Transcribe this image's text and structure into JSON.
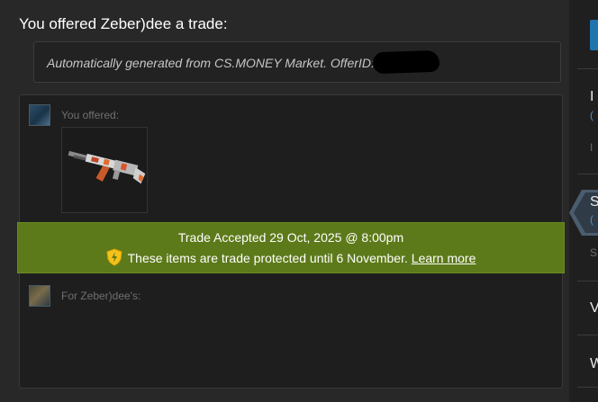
{
  "offer": {
    "heading": "You offered Zeber)dee a trade:",
    "message": "Automatically generated from CS.MONEY Market. OfferID:"
  },
  "trade": {
    "you_offered_label": "You offered:",
    "for_them_label": "For Zeber)dee's:",
    "items_offered": [
      {
        "name": "ak47-rifle-skin-icon"
      }
    ]
  },
  "banner": {
    "accepted": "Trade Accepted 29 Oct, 2025 @ 8:00pm",
    "protected": "These items are trade protected until 6 November.",
    "learn_more": "Learn more",
    "color": "#5d7a1a"
  },
  "sidebar": {
    "items": [
      {
        "letter": "I",
        "sub": "(",
        "dim": "I"
      },
      {
        "letter": "S",
        "sub": "(",
        "dim": "S"
      },
      {
        "letter": "V"
      },
      {
        "letter": "W"
      }
    ],
    "accent": "#1f74ae"
  }
}
